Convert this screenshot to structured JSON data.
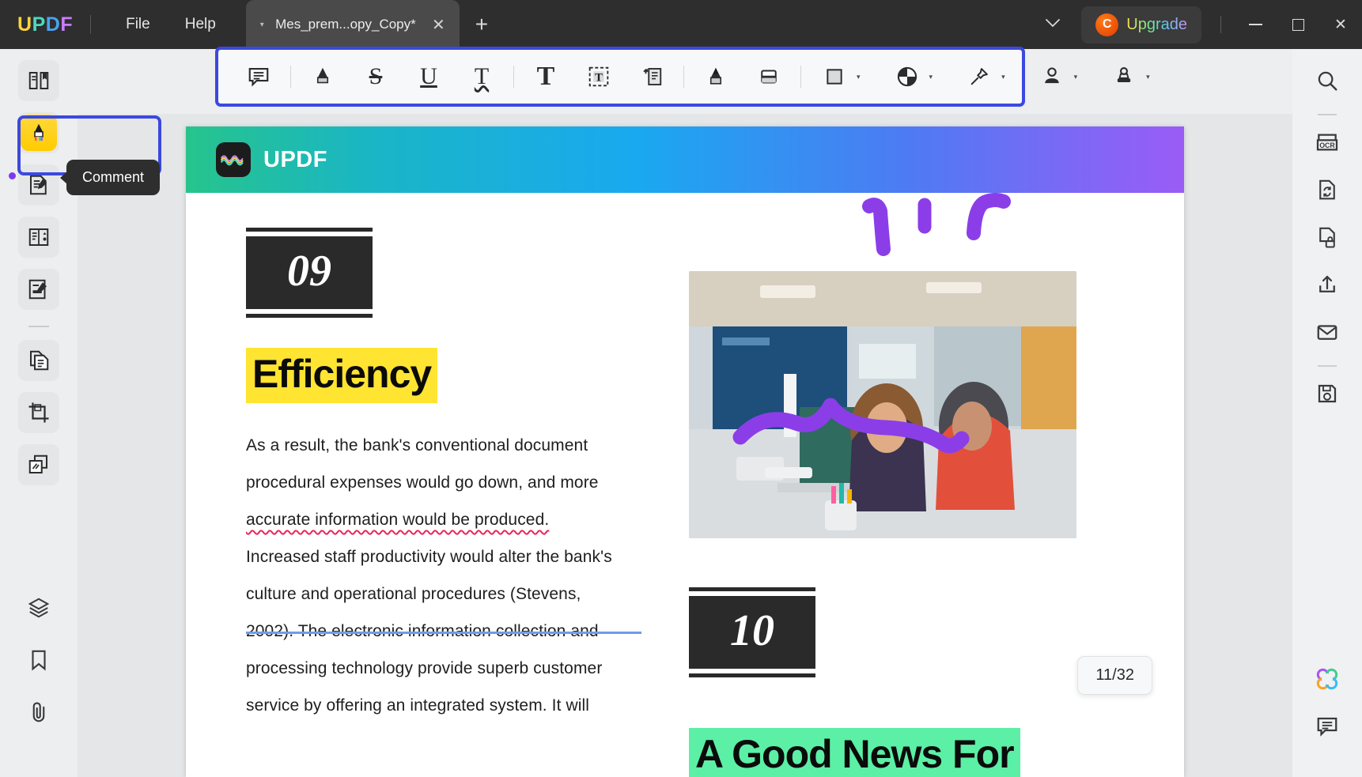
{
  "window": {
    "app_logo": [
      "U",
      "P",
      "D",
      "F"
    ],
    "menus": [
      {
        "label": "File",
        "name": "menu-file"
      },
      {
        "label": "Help",
        "name": "menu-help"
      }
    ],
    "tab": {
      "title": "Mes_prem...opy_Copy*",
      "close": "✕",
      "caret": "▾"
    },
    "new_tab": "+",
    "chevron": "⌄",
    "upgrade": {
      "badge": "C",
      "label": "Upgrade"
    },
    "controls": {
      "minimize": "minimize-icon",
      "maximize": "maximize-icon",
      "close": "✕"
    }
  },
  "left_rail": {
    "items": [
      {
        "name": "sidebar-reader",
        "icon": "reader-icon"
      },
      {
        "name": "sidebar-comment",
        "icon": "highlighter-icon"
      },
      {
        "name": "sidebar-edit-pdf",
        "icon": "edit-document-icon"
      },
      {
        "name": "sidebar-page-tools",
        "icon": "pages-icon"
      },
      {
        "name": "sidebar-form",
        "icon": "form-icon"
      }
    ],
    "items2": [
      {
        "name": "sidebar-convert",
        "icon": "convert-file-icon"
      },
      {
        "name": "sidebar-crop",
        "icon": "crop-icon"
      },
      {
        "name": "sidebar-batch",
        "icon": "batch-icon"
      }
    ],
    "bottom": [
      {
        "name": "sidebar-layers",
        "icon": "layers-icon"
      },
      {
        "name": "sidebar-bookmark",
        "icon": "bookmark-icon"
      },
      {
        "name": "sidebar-attachment",
        "icon": "paperclip-icon"
      }
    ],
    "tooltip": "Comment"
  },
  "annotation_toolbar": {
    "tools": [
      {
        "name": "tool-note",
        "icon": "sticky-note-icon",
        "label": "Note"
      },
      {
        "name": "tool-highlight",
        "icon": "highlighter-icon",
        "label": "Highlight"
      },
      {
        "name": "tool-strikethrough",
        "icon": "strikethrough-icon",
        "label": "S"
      },
      {
        "name": "tool-underline",
        "icon": "underline-icon",
        "label": "U"
      },
      {
        "name": "tool-squiggly",
        "icon": "squiggly-underline-icon",
        "label": "T"
      },
      {
        "name": "tool-text",
        "icon": "text-icon",
        "label": "T"
      },
      {
        "name": "tool-textbox",
        "icon": "text-box-icon",
        "label": "T"
      },
      {
        "name": "tool-callout",
        "icon": "callout-icon",
        "label": "Callout"
      },
      {
        "name": "tool-pencil",
        "icon": "pencil-icon",
        "label": "Pencil"
      },
      {
        "name": "tool-eraser",
        "icon": "eraser-icon",
        "label": "Eraser"
      },
      {
        "name": "tool-shapes",
        "icon": "shape-square-icon",
        "label": "Shapes"
      },
      {
        "name": "tool-sticker",
        "icon": "sticker-icon",
        "label": "Sticker"
      },
      {
        "name": "tool-pin",
        "icon": "pin-icon",
        "label": "Pin"
      },
      {
        "name": "tool-signature",
        "icon": "signature-person-icon",
        "label": "Signature"
      },
      {
        "name": "tool-stamp",
        "icon": "stamp-icon",
        "label": "Stamp"
      }
    ],
    "caret": "▾"
  },
  "document": {
    "banner_title": "UPDF",
    "left_column": {
      "number": "09",
      "heading": "Efficiency",
      "paragraph_lines": [
        "As a result, the bank's conventional document",
        "procedural expenses would go down, and more",
        "accurate  information  would  be  produced.",
        "Increased staff productivity would alter the bank's",
        "culture and operational procedures (Stevens,",
        "2002). The electronic information collection and",
        "processing technology provide superb customer",
        "service by offering an integrated system. It will"
      ]
    },
    "right_column": {
      "number": "10",
      "heading": "A Good News For"
    },
    "page_indicator": "11/32"
  },
  "right_rail": {
    "items": [
      {
        "name": "search-button",
        "icon": "search-icon"
      },
      {
        "name": "ocr-button",
        "icon": "ocr-icon"
      },
      {
        "name": "convert-button",
        "icon": "convert-icon"
      },
      {
        "name": "protect-button",
        "icon": "lock-document-icon"
      },
      {
        "name": "share-button",
        "icon": "share-upload-icon"
      },
      {
        "name": "email-button",
        "icon": "envelope-icon"
      },
      {
        "name": "save-button",
        "icon": "save-disk-icon"
      }
    ],
    "bottom": [
      {
        "name": "ai-assistant-button",
        "icon": "ai-flower-icon"
      },
      {
        "name": "comment-list-button",
        "icon": "comment-bubble-icon"
      }
    ]
  },
  "colors": {
    "accent": "#3b49df",
    "highlight_yellow": "#ffe431",
    "highlight_green": "#5bf0a5",
    "ink_purple": "#8b3ee8",
    "squiggly_red": "#e8275a",
    "strike_blue": "#6f9de8"
  }
}
